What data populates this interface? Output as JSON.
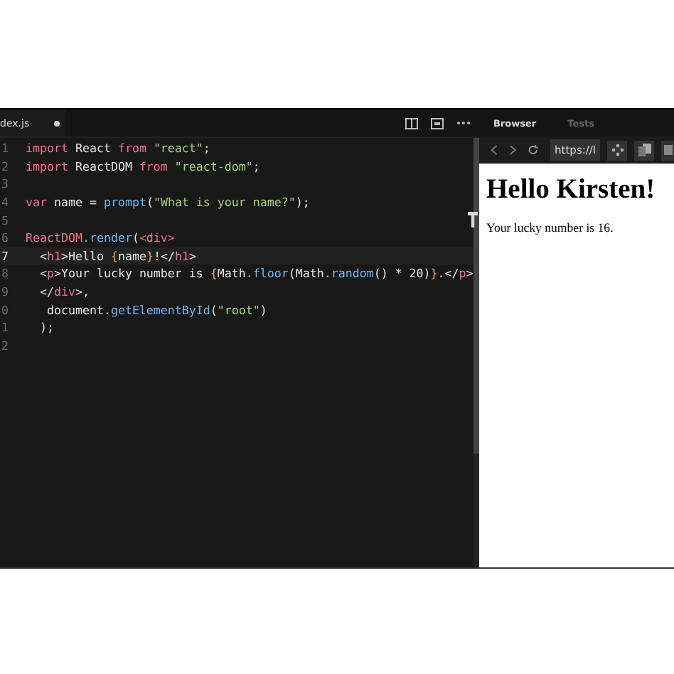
{
  "editor": {
    "tab": {
      "label": "dex.js",
      "modified": true
    },
    "lines": [
      {
        "number": "1",
        "current": false,
        "tokens": [
          {
            "kind": "keyword",
            "text": "import"
          },
          {
            "kind": "plain",
            "text": " React "
          },
          {
            "kind": "keyword",
            "text": "from "
          },
          {
            "kind": "string",
            "text": "\"react\""
          },
          {
            "kind": "plain",
            "text": ";"
          }
        ]
      },
      {
        "number": "2",
        "current": false,
        "tokens": [
          {
            "kind": "keyword",
            "text": "import"
          },
          {
            "kind": "plain",
            "text": " ReactDOM "
          },
          {
            "kind": "keyword",
            "text": "from "
          },
          {
            "kind": "string",
            "text": "\"react-dom\""
          },
          {
            "kind": "plain",
            "text": ";"
          }
        ]
      },
      {
        "number": "3",
        "current": false
      },
      {
        "number": "4",
        "current": false,
        "tokens": [
          {
            "kind": "keyword",
            "text": "var"
          },
          {
            "kind": "plain",
            "text": " name = "
          },
          {
            "kind": "function",
            "text": "prompt"
          },
          {
            "kind": "plain",
            "text": "("
          },
          {
            "kind": "string",
            "text": "\"What is your name?\""
          },
          {
            "kind": "plain",
            "text": ");"
          }
        ]
      },
      {
        "number": "5",
        "current": false
      },
      {
        "number": "6",
        "current": false,
        "tokens": [
          {
            "kind": "keyword",
            "text": "ReactDOM"
          },
          {
            "kind": "function",
            "text": ".render"
          },
          {
            "kind": "plain",
            "text": "("
          },
          {
            "kind": "tag",
            "text": "<div>"
          }
        ]
      },
      {
        "number": "7",
        "current": true,
        "tokens": [
          {
            "kind": "plain",
            "text": "  <"
          },
          {
            "kind": "tag",
            "text": "h1"
          },
          {
            "kind": "plain",
            "text": ">Hello "
          },
          {
            "kind": "brace",
            "text": "{"
          },
          {
            "kind": "plain",
            "text": "name"
          },
          {
            "kind": "brace",
            "text": "}"
          },
          {
            "kind": "plain",
            "text": "!</"
          },
          {
            "kind": "tag",
            "text": "h1"
          },
          {
            "kind": "plain",
            "text": ">"
          }
        ]
      },
      {
        "number": "8",
        "current": false,
        "tokens": [
          {
            "kind": "plain",
            "text": "  <"
          },
          {
            "kind": "tag",
            "text": "p"
          },
          {
            "kind": "plain",
            "text": ">Your lucky number is "
          },
          {
            "kind": "brace",
            "text": "{"
          },
          {
            "kind": "plain",
            "text": "Math"
          },
          {
            "kind": "function",
            "text": ".floor"
          },
          {
            "kind": "plain",
            "text": "(Math"
          },
          {
            "kind": "function",
            "text": ".random"
          },
          {
            "kind": "plain",
            "text": "() * 20)"
          },
          {
            "kind": "brace",
            "text": "}"
          },
          {
            "kind": "plain",
            "text": ".</"
          },
          {
            "kind": "tag",
            "text": "p"
          },
          {
            "kind": "plain",
            "text": ">"
          }
        ]
      },
      {
        "number": "9",
        "current": false,
        "tokens": [
          {
            "kind": "plain",
            "text": "  </"
          },
          {
            "kind": "tag",
            "text": "div"
          },
          {
            "kind": "plain",
            "text": ">,"
          }
        ]
      },
      {
        "number": "0",
        "current": false,
        "tokens": [
          {
            "kind": "plain",
            "text": "   document."
          },
          {
            "kind": "function",
            "text": "getElementById"
          },
          {
            "kind": "plain",
            "text": "("
          },
          {
            "kind": "string",
            "text": "\"root\""
          },
          {
            "kind": "plain",
            "text": ")"
          }
        ]
      },
      {
        "number": "1",
        "current": false,
        "tokens": [
          {
            "kind": "plain",
            "text": "  );"
          }
        ]
      },
      {
        "number": "2",
        "current": false
      }
    ]
  },
  "browser": {
    "tabs": [
      {
        "label": "Browser",
        "selected": true
      },
      {
        "label": "Tests",
        "selected": false
      }
    ],
    "url": "https://l",
    "heading": "Hello Kirsten!",
    "paragraph": "Your lucky number is 16."
  }
}
